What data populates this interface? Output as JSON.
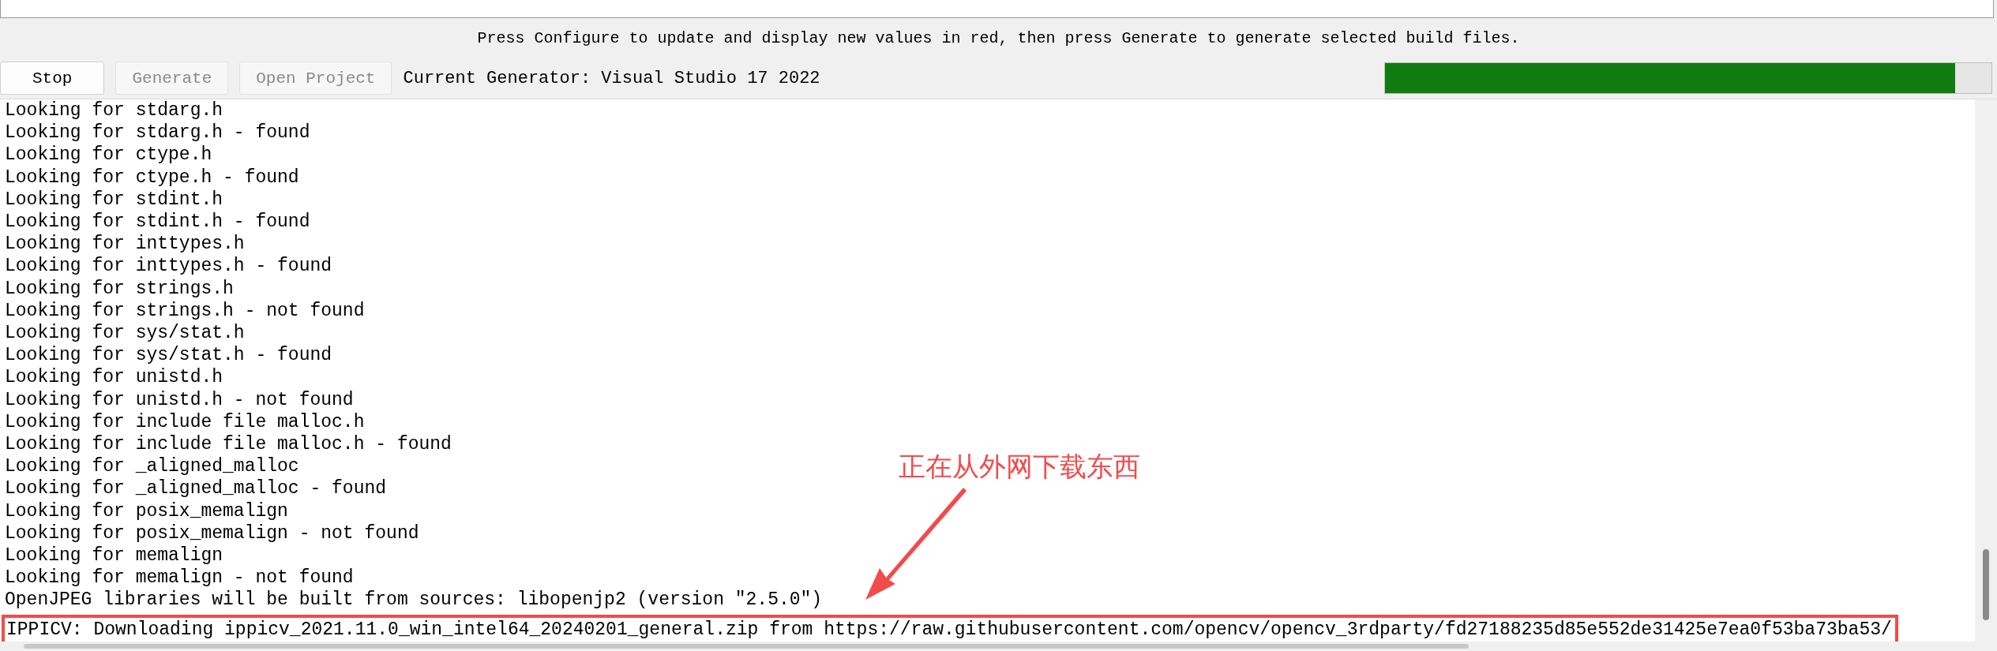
{
  "hint": "Press Configure to update and display new values in red, then press Generate to generate selected build files.",
  "toolbar": {
    "buttons": [
      {
        "label": "Stop",
        "disabled": false
      },
      {
        "label": "Generate",
        "disabled": true
      },
      {
        "label": "Open Project",
        "disabled": true
      }
    ],
    "generator": "Current Generator: Visual Studio 17 2022",
    "progress": {
      "level": 0.94
    }
  },
  "log": [
    {
      "text": "Looking for stdarg.h",
      "highlighted": false
    },
    {
      "text": "Looking for stdarg.h - found",
      "highlighted": false
    },
    {
      "text": "Looking for ctype.h",
      "highlighted": false
    },
    {
      "text": "Looking for ctype.h - found",
      "highlighted": false
    },
    {
      "text": "Looking for stdint.h",
      "highlighted": false
    },
    {
      "text": "Looking for stdint.h - found",
      "highlighted": false
    },
    {
      "text": "Looking for inttypes.h",
      "highlighted": false
    },
    {
      "text": "Looking for inttypes.h - found",
      "highlighted": false
    },
    {
      "text": "Looking for strings.h",
      "highlighted": false
    },
    {
      "text": "Looking for strings.h - not found",
      "highlighted": false
    },
    {
      "text": "Looking for sys/stat.h",
      "highlighted": false
    },
    {
      "text": "Looking for sys/stat.h - found",
      "highlighted": false
    },
    {
      "text": "Looking for unistd.h",
      "highlighted": false
    },
    {
      "text": "Looking for unistd.h - not found",
      "highlighted": false
    },
    {
      "text": "Looking for include file malloc.h",
      "highlighted": false
    },
    {
      "text": "Looking for include file malloc.h - found",
      "highlighted": false
    },
    {
      "text": "Looking for _aligned_malloc",
      "highlighted": false
    },
    {
      "text": "Looking for _aligned_malloc - found",
      "highlighted": false
    },
    {
      "text": "Looking for posix_memalign",
      "highlighted": false
    },
    {
      "text": "Looking for posix_memalign - not found",
      "highlighted": false
    },
    {
      "text": "Looking for memalign",
      "highlighted": false
    },
    {
      "text": "Looking for memalign - not found",
      "highlighted": false
    },
    {
      "text": "OpenJPEG libraries will be built from sources: libopenjp2 (version \"2.5.0\")",
      "highlighted": false
    },
    {
      "text": "IPPICV: Downloading ippicv_2021.11.0_win_intel64_20240201_general.zip from https://raw.githubusercontent.com/opencv/opencv_3rdparty/fd27188235d85e552de31425e7ea0f53ba73ba53/",
      "highlighted": true
    }
  ],
  "annotation": {
    "text": "正在从外网下载东西"
  }
}
